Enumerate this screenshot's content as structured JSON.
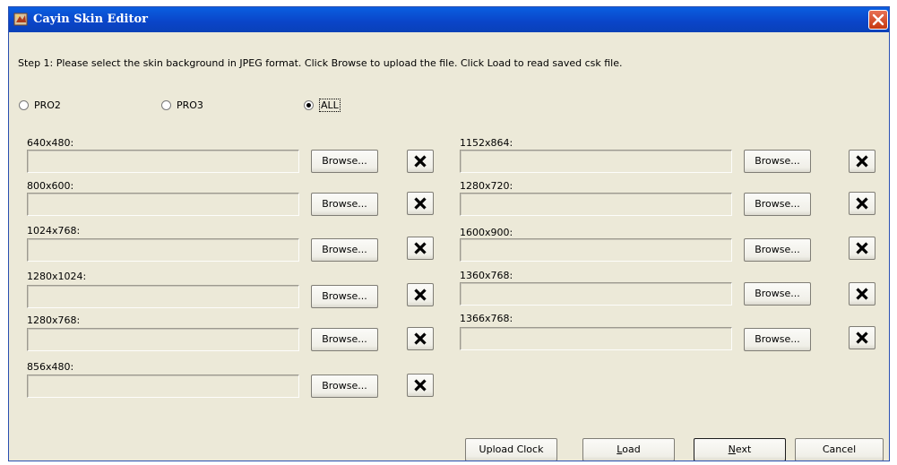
{
  "window": {
    "title": "Cayin Skin Editor"
  },
  "instruction": "Step 1: Please select the skin background in JPEG format. Click Browse to upload the file. Click Load to read saved csk file.",
  "radios": [
    {
      "label": "PRO2",
      "checked": false
    },
    {
      "label": "PRO3",
      "checked": false
    },
    {
      "label": "ALL",
      "checked": true
    }
  ],
  "left_slots": [
    {
      "label": "640x480:",
      "value": "",
      "browse": "Browse..."
    },
    {
      "label": "800x600:",
      "value": "",
      "browse": "Browse..."
    },
    {
      "label": "1024x768:",
      "value": "",
      "browse": "Browse..."
    },
    {
      "label": "1280x1024:",
      "value": "",
      "browse": "Browse..."
    },
    {
      "label": "1280x768:",
      "value": "",
      "browse": "Browse..."
    },
    {
      "label": "856x480:",
      "value": "",
      "browse": "Browse..."
    }
  ],
  "right_slots": [
    {
      "label": "1152x864:",
      "value": "",
      "browse": "Browse..."
    },
    {
      "label": "1280x720:",
      "value": "",
      "browse": "Browse..."
    },
    {
      "label": "1600x900:",
      "value": "",
      "browse": "Browse..."
    },
    {
      "label": "1360x768:",
      "value": "",
      "browse": "Browse..."
    },
    {
      "label": "1366x768:",
      "value": "",
      "browse": "Browse..."
    }
  ],
  "buttons": {
    "upload_clock": "Upload Clock",
    "load_first": "L",
    "load_rest": "oad",
    "next_first": "N",
    "next_rest": "ext",
    "cancel": "Cancel"
  },
  "colors": {
    "titlebar": "#0a5fe0",
    "dialog_bg": "#ece9d8",
    "close": "#d8512b"
  }
}
